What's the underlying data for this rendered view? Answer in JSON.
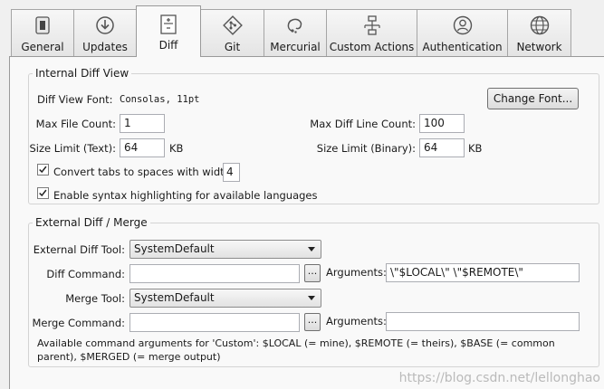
{
  "tabs": [
    {
      "label": "General",
      "icon": "switch-icon"
    },
    {
      "label": "Updates",
      "icon": "download-icon"
    },
    {
      "label": "Diff",
      "icon": "diff-icon"
    },
    {
      "label": "Git",
      "icon": "git-icon"
    },
    {
      "label": "Mercurial",
      "icon": "mercurial-icon"
    },
    {
      "label": "Custom Actions",
      "icon": "flowchart-icon"
    },
    {
      "label": "Authentication",
      "icon": "user-icon"
    },
    {
      "label": "Network",
      "icon": "globe-icon"
    }
  ],
  "active_tab": "Diff",
  "internal": {
    "title": "Internal Diff View",
    "font_label": "Diff View Font:",
    "font_value": "Consolas, 11pt",
    "change_font": "Change Font...",
    "max_file_count_label": "Max File Count:",
    "max_file_count": "1",
    "max_line_count_label": "Max Diff Line Count:",
    "max_line_count": "100",
    "size_text_label": "Size Limit (Text):",
    "size_text": "64",
    "size_text_unit": "KB",
    "size_binary_label": "Size Limit (Binary):",
    "size_binary": "64",
    "size_binary_unit": "KB",
    "tabs_label": "Convert tabs to spaces with width:",
    "tabs_checked": true,
    "tab_width": "4",
    "syntax_label": "Enable syntax highlighting for available languages",
    "syntax_checked": true
  },
  "external": {
    "title": "External Diff / Merge",
    "diff_tool_label": "External Diff Tool:",
    "diff_tool": "SystemDefault",
    "diff_cmd_label": "Diff Command:",
    "diff_cmd": "",
    "browse": "...",
    "args_label": "Arguments:",
    "diff_args": "\\\"$LOCAL\\\" \\\"$REMOTE\\\"",
    "merge_tool_label": "Merge Tool:",
    "merge_tool": "SystemDefault",
    "merge_cmd_label": "Merge Command:",
    "merge_cmd": "",
    "merge_args": "",
    "note": "Available command arguments for 'Custom': $LOCAL (= mine), $REMOTE (= theirs), $BASE (= common parent), $MERGED (= merge output)"
  },
  "watermark": "https://blog.csdn.net/lellonghao",
  "colors": {
    "border": "#a5a5a5",
    "panel": "#f9f9f9",
    "background": "#f0f0f0"
  }
}
